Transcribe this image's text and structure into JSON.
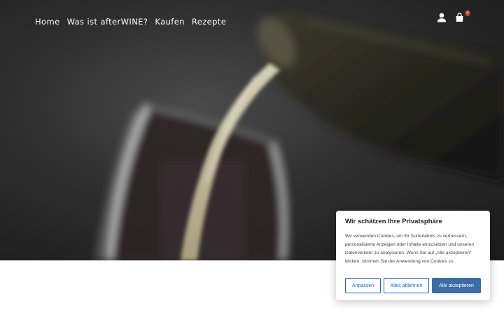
{
  "nav": {
    "items": [
      "Home",
      "Was ist afterWINE?",
      "Kaufen",
      "Rezepte"
    ],
    "icons": [
      "user-icon",
      "shopping-bag-icon"
    ],
    "cart_count": "0"
  },
  "cookie_banner": {
    "title": "Wir schätzen Ihre Privatsphäre",
    "text": "Wir verwenden Cookies, um Ihr Surferlebnis zu verbessern, personalisierte Anzeigen oder Inhalte einzusetzen und unseren Datenverkehr zu analysieren. Wenn Sie auf „Alle akzeptieren“ klicken, stimmen Sie der Anwendung von Cookies zu.",
    "buttons": {
      "customize": "Anpassen",
      "reject": "Alles ablehnen",
      "accept": "Alle akzeptieren"
    }
  },
  "colors": {
    "primary": "#1863dc",
    "accept_bg": "#3a6ea5",
    "hero_dark": "#1a1a1a"
  }
}
